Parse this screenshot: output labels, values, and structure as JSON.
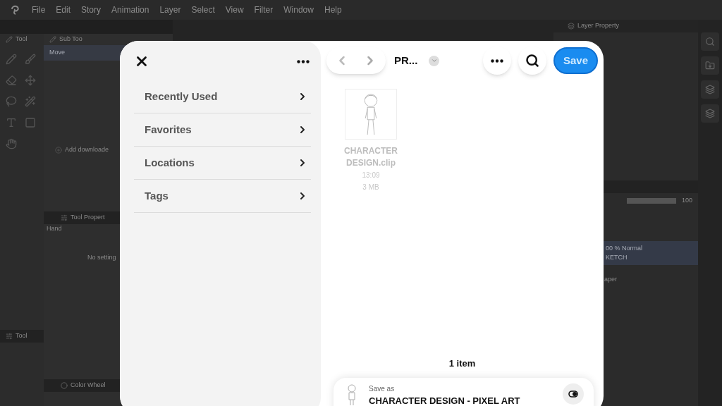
{
  "menu_bar": {
    "items": [
      "File",
      "Edit",
      "Story",
      "Animation",
      "Layer",
      "Select",
      "View",
      "Filter",
      "Window",
      "Help"
    ]
  },
  "left_panels": {
    "tool_tab": "Tool",
    "sub_tool_tab": "Sub Too",
    "sub_tool_items": [
      "Move"
    ],
    "add_link": "Add downloade",
    "tool_property_tab": "Tool Propert",
    "tool_property_name": "Hand",
    "tool_property_empty": "No setting",
    "bottom_tool_tab": "Tool",
    "color_wheel_tab": "Color Wheel"
  },
  "layer_panel": {
    "tab": "Layer Property",
    "opacity": "100",
    "layer_mode": "00 % Normal",
    "layer_name": "KETCH",
    "paper_label": "aper"
  },
  "dialog": {
    "sidebar": {
      "items": [
        {
          "label": "Recently Used"
        },
        {
          "label": "Favorites"
        },
        {
          "label": "Locations"
        },
        {
          "label": "Tags"
        }
      ]
    },
    "folder_title": "PR...",
    "save_button": "Save",
    "files": [
      {
        "name": "CHARACTER DESIGN.clip",
        "time": "13:09",
        "size": "3 MB"
      }
    ],
    "item_count": "1 item",
    "save_as": {
      "label": "Save as",
      "file_name": "CHARACTER DESIGN - PIXEL ART"
    }
  }
}
